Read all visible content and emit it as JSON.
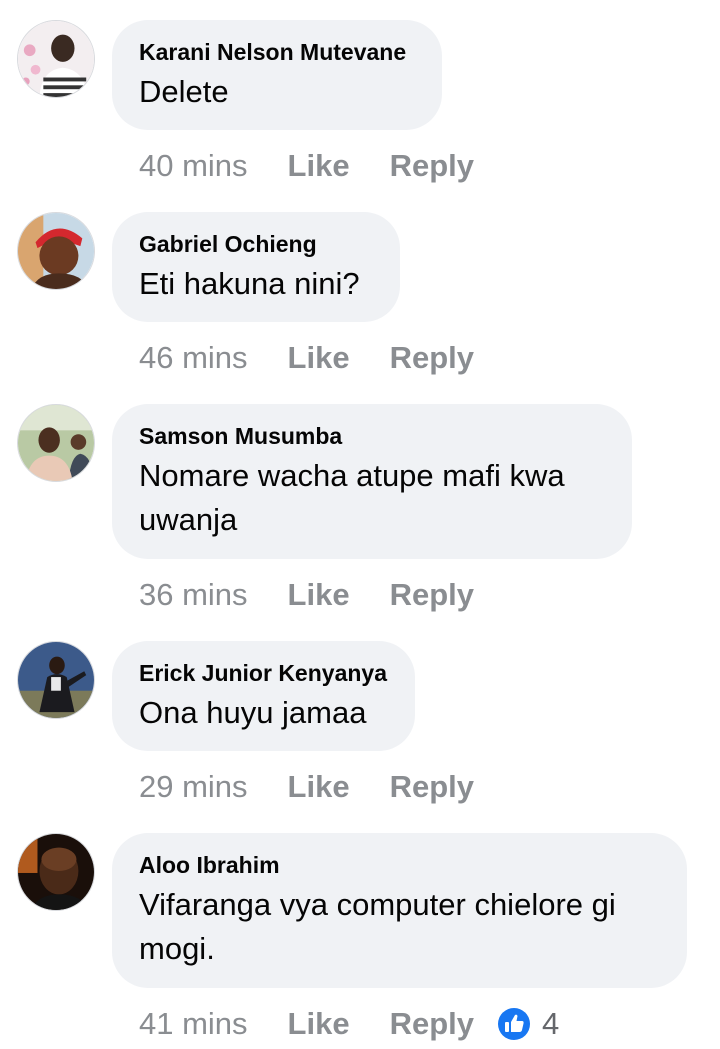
{
  "comments": [
    {
      "author": "Karani Nelson Mutevane",
      "text": "Delete",
      "time": "40 mins",
      "like_label": "Like",
      "reply_label": "Reply"
    },
    {
      "author": "Gabriel Ochieng",
      "text": "Eti hakuna nini?",
      "time": "46 mins",
      "like_label": "Like",
      "reply_label": "Reply"
    },
    {
      "author": "Samson Musumba",
      "text": "Nomare wacha atupe mafi kwa uwanja",
      "time": "36 mins",
      "like_label": "Like",
      "reply_label": "Reply"
    },
    {
      "author": "Erick Junior Kenyanya",
      "text": "Ona huyu jamaa",
      "time": "29 mins",
      "like_label": "Like",
      "reply_label": "Reply"
    },
    {
      "author": "Aloo Ibrahim",
      "text": "Vifaranga vya computer chielore gi mogi.",
      "time": "41 mins",
      "like_label": "Like",
      "reply_label": "Reply",
      "reaction_icon": "like-thumb-icon",
      "reaction_count": "4"
    }
  ],
  "colors": {
    "bubble": "#f0f2f5",
    "meta_text": "#8a8d91",
    "like_reaction": "#1877f2"
  }
}
